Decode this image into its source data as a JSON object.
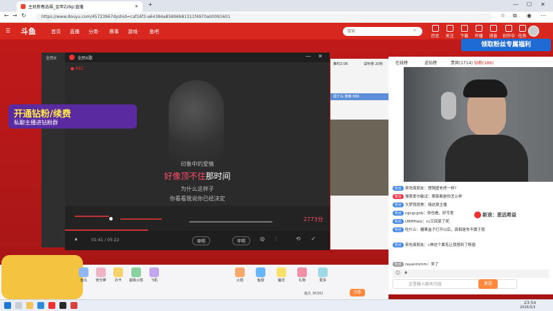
{
  "browser": {
    "tab_title": "主机新春选福_金甲ZzNjc直播",
    "url": "https://www.douyu.com/45723967dyshid=caf16f3-a64384a85896b81311f4970a00091601"
  },
  "site": {
    "logo": "斗鱼",
    "nav": [
      "首页",
      "直播",
      "分类·",
      "赛事",
      "游戏·",
      "鱼吧"
    ],
    "search_placeholder": "搜索",
    "header_icons": [
      "历史",
      "关注",
      "下载",
      "开播",
      "消息",
      "创作中心",
      "任务"
    ]
  },
  "overlay": {
    "fan_button": "领取粉丝专属福利",
    "promo_title": "开通钻粉/续费",
    "promo_sub": "私聊主播进钻粉群"
  },
  "ktv": {
    "title": "全民K歌",
    "rec": "REC",
    "lyrics": [
      "印象中的爱情",
      "好像顶不住那时间",
      "为什么这样子",
      "你看看我说你已经决定"
    ],
    "lyric_highlight": "好像顶不住",
    "lyric_rest": "那时间",
    "score": "2773分",
    "time": "01:41 / 05:22",
    "buttons": [
      "原唱",
      "伴唱"
    ],
    "side_label": "全民K"
  },
  "chat": {
    "tabs": [
      "在线榜",
      "送钻榜",
      "贵宾(1714)",
      "钻粉(186)"
    ],
    "lines": [
      "来吃面朋友：想隔壁老虎一样?",
      "搜索爱尔敏试：哪家都是你怎么样",
      "大梦我很美：嗨这狼主播",
      "cgcgcgnb：你也看，好可爱",
      "URMHalo：cc又回家了呢",
      "吃什么：糟果盒子打开以后，真相是你不属于我",
      "来吃面朋友：c神这个属毛让我想到了断眉",
      "rayanmmm：来了"
    ],
    "input_placeholder": "这里输入聊天内容",
    "send": "发送",
    "weibo": "新浪：思远希益"
  },
  "stream": {
    "top_labels": [
      "推时2:06",
      "试听榜 20秒"
    ],
    "banner": "领了么 搜索 666"
  },
  "bottom": {
    "gifts": [
      "鱼丸",
      "荧光棒",
      "办卡",
      "超级火箭",
      "飞机",
      "火箭",
      "鱼翅",
      "魔法",
      "礼物",
      "更多"
    ],
    "count": "鱼丸 36392",
    "charge": "充值"
  },
  "taskbar": {
    "time": "23:54",
    "date": "2026/3/3"
  }
}
